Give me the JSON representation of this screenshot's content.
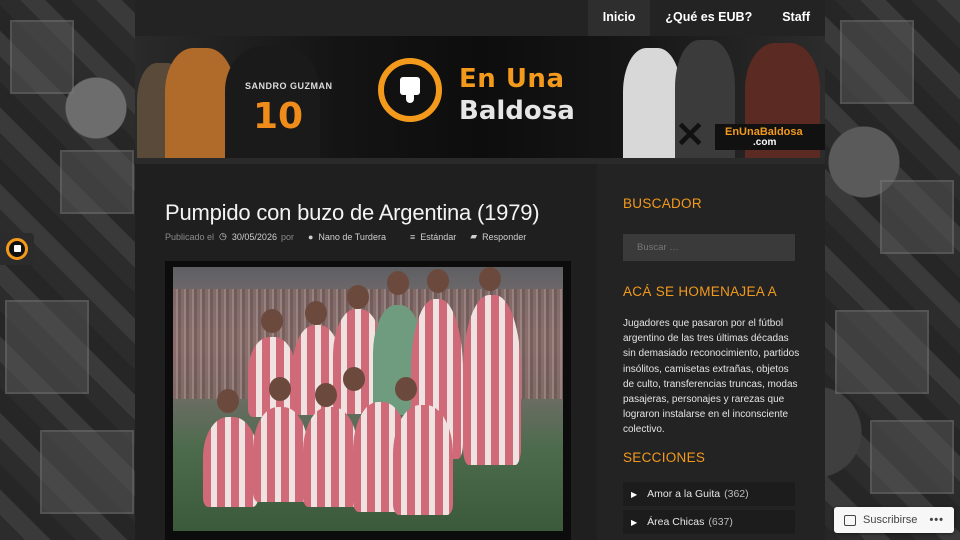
{
  "nav": {
    "items": [
      {
        "label": "Inicio",
        "active": true
      },
      {
        "label": "¿Qué es EUB?",
        "active": false
      },
      {
        "label": "Staff",
        "active": false
      }
    ]
  },
  "banner": {
    "logo_line1": "En Una",
    "logo_line2": "Baldosa",
    "jersey_name": "SANDRO GUZMAN",
    "jersey_number": "10",
    "site_badge_line1": "EnUnaBaldosa",
    "site_badge_line2": ".com",
    "logo_icon": "thumbs-down-icon",
    "accent_color": "#f39a1d"
  },
  "post": {
    "title": "Pumpido con buzo de Argentina (1979)",
    "published_label": "Publicado el",
    "date": "30/05/2026",
    "by_label": "por",
    "author": "Nano de Turdera",
    "format": "Estándar",
    "reply_label": "Responder"
  },
  "sidebar": {
    "search_title": "BUSCADOR",
    "search_placeholder": "Buscar …",
    "tribute_title": "ACÁ SE HOMENAJEA A",
    "tribute_text": "Jugadores que pasaron por el fútbol argentino de las tres últimas décadas sin demasiado reconocimiento, partidos insólitos, camisetas extrañas, objetos de culto, transferencias truncas, modas pasajeras, personajes y rarezas que lograron instalarse en el inconsciente colectivo.",
    "sections_title": "SECCIONES",
    "sections": [
      {
        "label": "Amor a la Guita",
        "count": "(362)"
      },
      {
        "label": "Área Chicas",
        "count": "(637)"
      }
    ]
  },
  "subscribe": {
    "label": "Suscribirse",
    "more": "•••"
  }
}
